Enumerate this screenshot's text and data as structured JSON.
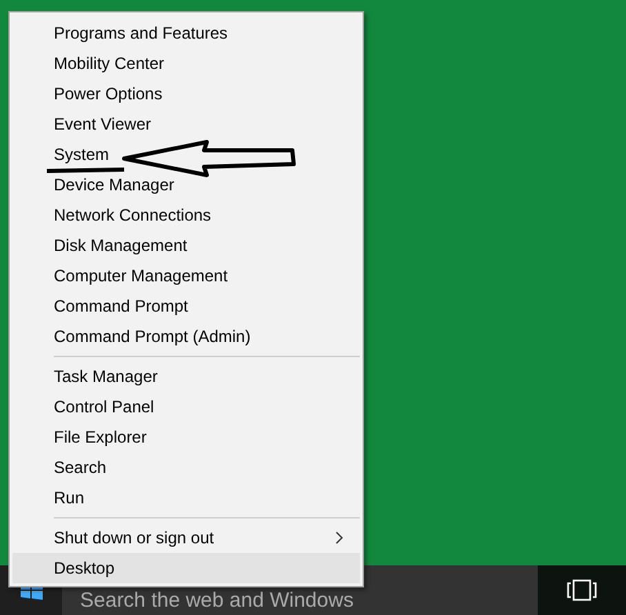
{
  "menu": {
    "groups": [
      {
        "items": [
          {
            "label": "Programs and Features",
            "kind": "item",
            "selected": false
          },
          {
            "label": "Mobility Center",
            "kind": "item",
            "selected": false
          },
          {
            "label": "Power Options",
            "kind": "item",
            "selected": false
          },
          {
            "label": "Event Viewer",
            "kind": "item",
            "selected": false
          },
          {
            "label": "System",
            "kind": "item",
            "selected": false
          },
          {
            "label": "Device Manager",
            "kind": "item",
            "selected": false
          },
          {
            "label": "Network Connections",
            "kind": "item",
            "selected": false
          },
          {
            "label": "Disk Management",
            "kind": "item",
            "selected": false
          },
          {
            "label": "Computer Management",
            "kind": "item",
            "selected": false
          },
          {
            "label": "Command Prompt",
            "kind": "item",
            "selected": false
          },
          {
            "label": "Command Prompt (Admin)",
            "kind": "item",
            "selected": false
          }
        ]
      },
      {
        "items": [
          {
            "label": "Task Manager",
            "kind": "item",
            "selected": false
          },
          {
            "label": "Control Panel",
            "kind": "item",
            "selected": false
          },
          {
            "label": "File Explorer",
            "kind": "item",
            "selected": false
          },
          {
            "label": "Search",
            "kind": "item",
            "selected": false
          },
          {
            "label": "Run",
            "kind": "item",
            "selected": false
          }
        ]
      },
      {
        "items": [
          {
            "label": "Shut down or sign out",
            "kind": "submenu",
            "selected": false
          },
          {
            "label": "Desktop",
            "kind": "item",
            "selected": true
          }
        ]
      }
    ]
  },
  "taskbar": {
    "search": {
      "placeholder": "Search the web and Windows"
    }
  }
}
